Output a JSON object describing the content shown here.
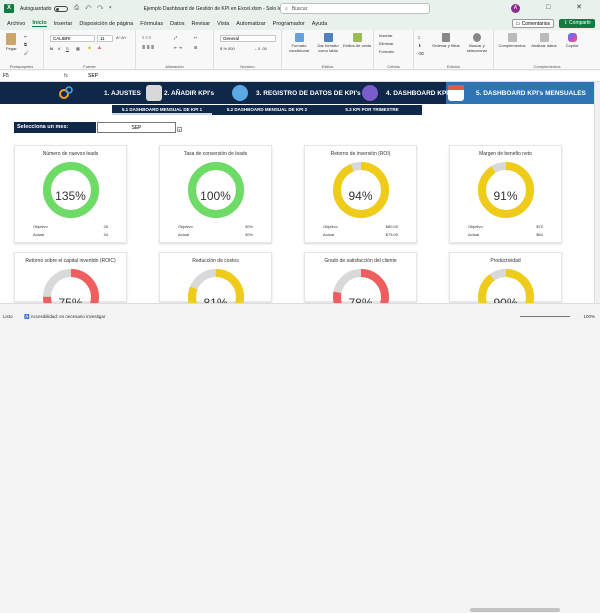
{
  "window": {
    "autosave_label": "Autoguardado",
    "doc_title": "Ejemplo Dashboard de Gestión de KPI en Excel.xlsm - Solo lec...",
    "search_placeholder": "Buscar",
    "user_initial": "A",
    "window_controls": "–  □  ✕"
  },
  "menu": {
    "tabs": [
      "Archivo",
      "Inicio",
      "Insertar",
      "Disposición de página",
      "Fórmulas",
      "Datos",
      "Revisar",
      "Vista",
      "Automatizar",
      "Programador",
      "Ayuda"
    ],
    "active_index": 1,
    "comments_label": "Comentarios",
    "share_label": "Compartir"
  },
  "ribbon": {
    "groups": [
      "Portapapeles",
      "Fuente",
      "Alineación",
      "Número",
      "Estilos",
      "Celdas",
      "Edición",
      "Complementos"
    ],
    "paste_label": "Pegar",
    "font_name": "CALIBRI",
    "font_size": "11",
    "number_format": "General",
    "styles_buttons": [
      "Formato condicional",
      "Dar formato como tabla",
      "Estilos de celda"
    ],
    "cells_buttons": [
      "Insertar",
      "Eliminar",
      "Formato"
    ],
    "edit_buttons": [
      "Ordenar y filtrar",
      "Buscar y seleccionar"
    ],
    "addin_buttons": [
      "Complementos",
      "Analizar datos",
      "Copilot"
    ]
  },
  "formula_bar": {
    "cell_ref": "F5",
    "fx": "fx",
    "value": "SEP"
  },
  "dashboard": {
    "nav": [
      {
        "label": "1. AJUSTES",
        "color": "#f0a030"
      },
      {
        "label": "2. AÑADIR KPI's",
        "color": "#e0e0e0"
      },
      {
        "label": "3. REGISTRO DE DATOS DE KPI's",
        "color": "#5aa9e6"
      },
      {
        "label": "4. DASHBOARD KPI",
        "color": "#7a5ccc"
      },
      {
        "label": "5. DASHBOARD KPI's MENSUALES",
        "color": "#e05a4a"
      }
    ],
    "subtabs": [
      "5.1 DASHBOARD MENSUAL DE KPI 1",
      "5.2 DASHBOARD MENSUAL DE KPI 2",
      "5.3 KPI POR TRIMESTRE"
    ],
    "month_label": "Selecciona un mes:",
    "month_value": "SEP",
    "colors": {
      "green": "#6ddb66",
      "yellow": "#f0cc1a",
      "red": "#ef5e5e",
      "track": "#d9d9d9"
    },
    "kpis": [
      {
        "title": "Número de nuevos leads",
        "pct_text": "135%",
        "fraction": 1.0,
        "color": "green",
        "objetivo_label": "Objetivo",
        "objetivo": "25",
        "actual_label": "Actual",
        "actual": "34"
      },
      {
        "title": "Tasa de conversión de leads",
        "pct_text": "100%",
        "fraction": 1.0,
        "color": "green",
        "objetivo_label": "Objetivo",
        "objetivo": "30%",
        "actual_label": "Actual",
        "actual": "30%"
      },
      {
        "title": "Retorno de inversión (ROI)",
        "pct_text": "94%",
        "fraction": 0.94,
        "color": "yellow",
        "objetivo_label": "Objetivo",
        "objetivo": "$80.00",
        "actual_label": "Actual",
        "actual": "$75.00"
      },
      {
        "title": "Margen de benefio neto",
        "pct_text": "91%",
        "fraction": 0.91,
        "color": "yellow",
        "objetivo_label": "Objetivo",
        "objetivo": "$70",
        "actual_label": "Actual",
        "actual": "$64"
      },
      {
        "title": "Retorno sobre el capital invertido (ROIC)",
        "pct_text": "75%",
        "fraction": 0.75,
        "color": "red"
      },
      {
        "title": "Reducción de costos",
        "pct_text": "81%",
        "fraction": 0.81,
        "color": "yellow"
      },
      {
        "title": "Grado de satisfacción del cliente",
        "pct_text": "78%",
        "fraction": 0.78,
        "color": "red"
      },
      {
        "title": "Productividad",
        "pct_text": "90%",
        "fraction": 0.9,
        "color": "yellow"
      }
    ]
  },
  "status": {
    "ready": "Listo",
    "accessibility": "Accesibilidad: es necesario investigar",
    "zoom": "100%"
  }
}
